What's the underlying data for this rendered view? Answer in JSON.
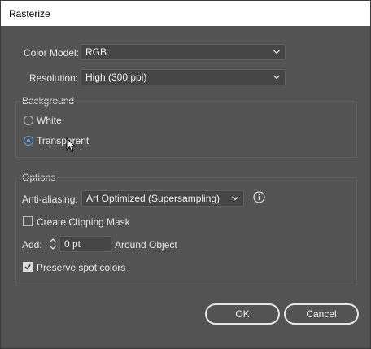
{
  "window": {
    "title": "Rasterize"
  },
  "color_model": {
    "label": "Color Model:",
    "value": "RGB"
  },
  "resolution": {
    "label": "Resolution:",
    "value": "High (300 ppi)"
  },
  "background": {
    "title": "Background",
    "options": [
      {
        "label": "White",
        "selected": false
      },
      {
        "label": "Transparent",
        "selected": true
      }
    ]
  },
  "options": {
    "title": "Options",
    "anti_aliasing": {
      "label": "Anti-aliasing:",
      "value": "Art Optimized (Supersampling)"
    },
    "clipping_mask": {
      "label": "Create Clipping Mask",
      "checked": false
    },
    "add": {
      "label": "Add:",
      "value": "0 pt",
      "suffix": "Around Object"
    },
    "spot_colors": {
      "label": "Preserve spot colors",
      "checked": true
    }
  },
  "buttons": {
    "ok": "OK",
    "cancel": "Cancel"
  },
  "colors": {
    "background": "#535353",
    "field": "#454545",
    "accent": "#5aa0e6"
  }
}
